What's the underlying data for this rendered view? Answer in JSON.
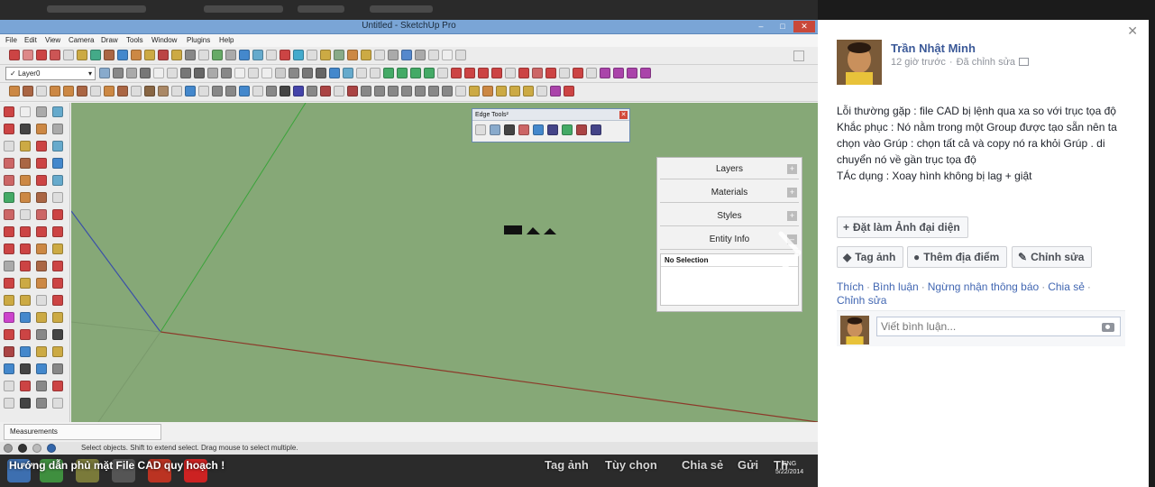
{
  "photo": {
    "window_title": "Untitled - SketchUp Pro",
    "menu": [
      "File",
      "Edit",
      "View",
      "Camera",
      "Draw",
      "Tools",
      "Window",
      "Plugins",
      "Help"
    ],
    "layer_select": "Layer0",
    "edge_tools_title": "Edge Tools²",
    "tray_items": [
      "Layers",
      "Materials",
      "Styles",
      "Entity Info"
    ],
    "entity_info_value": "No Selection",
    "measurements_label": "Measurements",
    "status_text": "Select objects. Shift to extend select. Drag mouse to select multiple.",
    "caption": "Hướng dẫn phủ mặt File CAD quy hoạch !",
    "actions": [
      "Tag ảnh",
      "Tùy chọn",
      "Chia sẻ",
      "Gửi",
      "Th"
    ],
    "clock_lang": "ENG",
    "clock_date": "5/22/2014"
  },
  "post": {
    "author": "Trần Nhật Minh",
    "time": "12 giờ trước",
    "edited": "Đã chỉnh sửa",
    "lines": [
      "Lỗi thường gặp : file CAD bị lệnh qua xa so với trục tọa độ",
      "Khắc phục : Nó nằm trong một Group được tạo sẵn nên ta chọn vào Grúp : chọn tất cả và copy nó ra khỏi Grúp . di chuyển nó về gần trục tọa độ",
      "TÁc dụng : Xoay hình không bị lag + giật"
    ],
    "buttons": {
      "profile": "Đặt làm Ảnh đại diện",
      "tag": "Tag ảnh",
      "location": "Thêm địa điểm",
      "edit": "Chỉnh sửa"
    },
    "links": [
      "Thích",
      "Bình luận",
      "Ngừng nhận thông báo",
      "Chia sẻ",
      "Chỉnh sửa"
    ],
    "comment_placeholder": "Viết bình luận..."
  },
  "colors": {
    "link": "#4267b2",
    "author": "#3b5998",
    "viewport_ground": "#86a877",
    "red_axis": "#8c3a2a",
    "green_axis": "#3aa33a",
    "blue_axis": "#3a4fa8"
  }
}
